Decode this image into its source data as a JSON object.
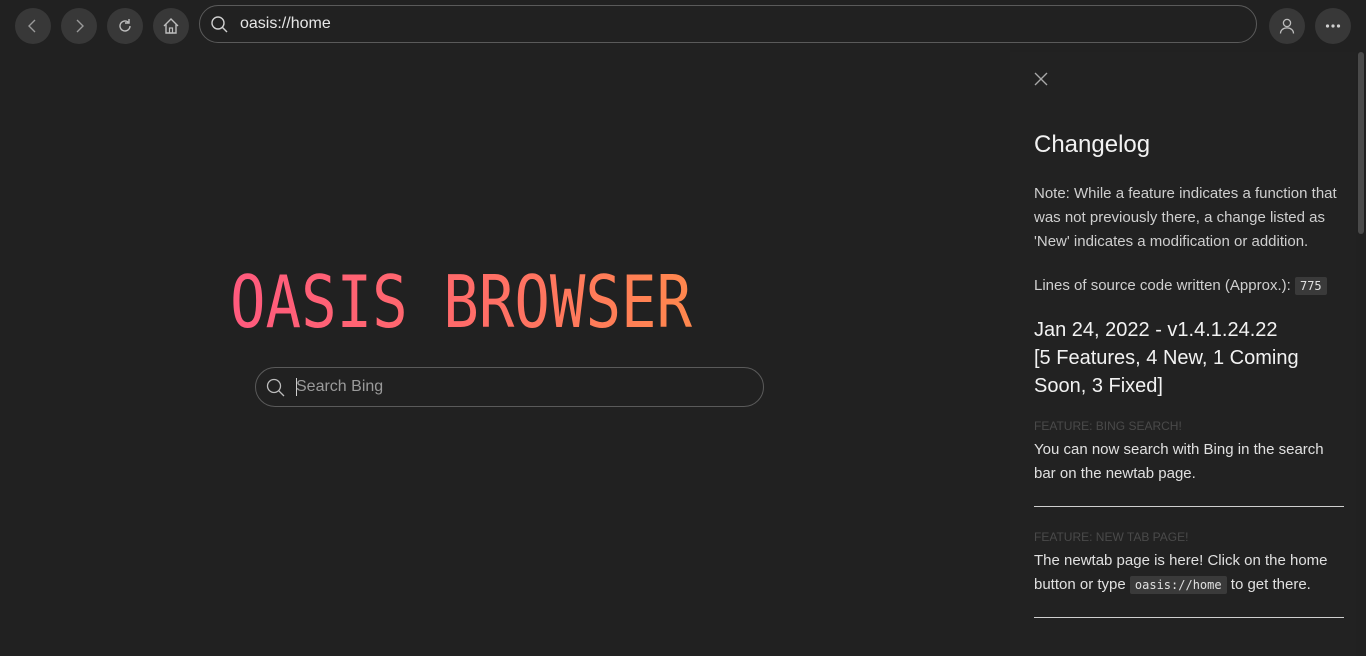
{
  "toolbar": {
    "back_icon": "chevron-left-icon",
    "forward_icon": "chevron-right-icon",
    "reload_icon": "reload-icon",
    "home_icon": "home-icon",
    "profile_icon": "user-icon",
    "menu_icon": "more-icon",
    "button_bg": "#383838"
  },
  "address": {
    "value": "oasis://home",
    "icon": "search-icon"
  },
  "newtab": {
    "title": "OASIS BROWSER",
    "title_gradient": [
      "#ff5a7e",
      "#ff8b4a"
    ],
    "search_placeholder": "Search Bing",
    "search_icon": "search-icon"
  },
  "changelog": {
    "close_icon": "close-icon",
    "title": "Changelog",
    "note": "Note: While a feature indicates a function that was not previously there, a change listed as 'New' indicates a modification or addition.",
    "lines_label": "Lines of source code written (Approx.):",
    "lines_value": "775",
    "version_line1": "Jan 24, 2022 - v1.4.1.24.22",
    "version_line2": "[5 Features, 4 New, 1 Coming Soon, 3 Fixed]",
    "entries": [
      {
        "tag": "FEATURE: BING SEARCH!",
        "text": "You can now search with Bing in the search bar on the newtab page."
      },
      {
        "tag": "FEATURE: NEW TAB PAGE!",
        "text_before": "The newtab page is here! Click on the home button or type",
        "code": "oasis://home",
        "text_after": "to get there."
      }
    ]
  }
}
